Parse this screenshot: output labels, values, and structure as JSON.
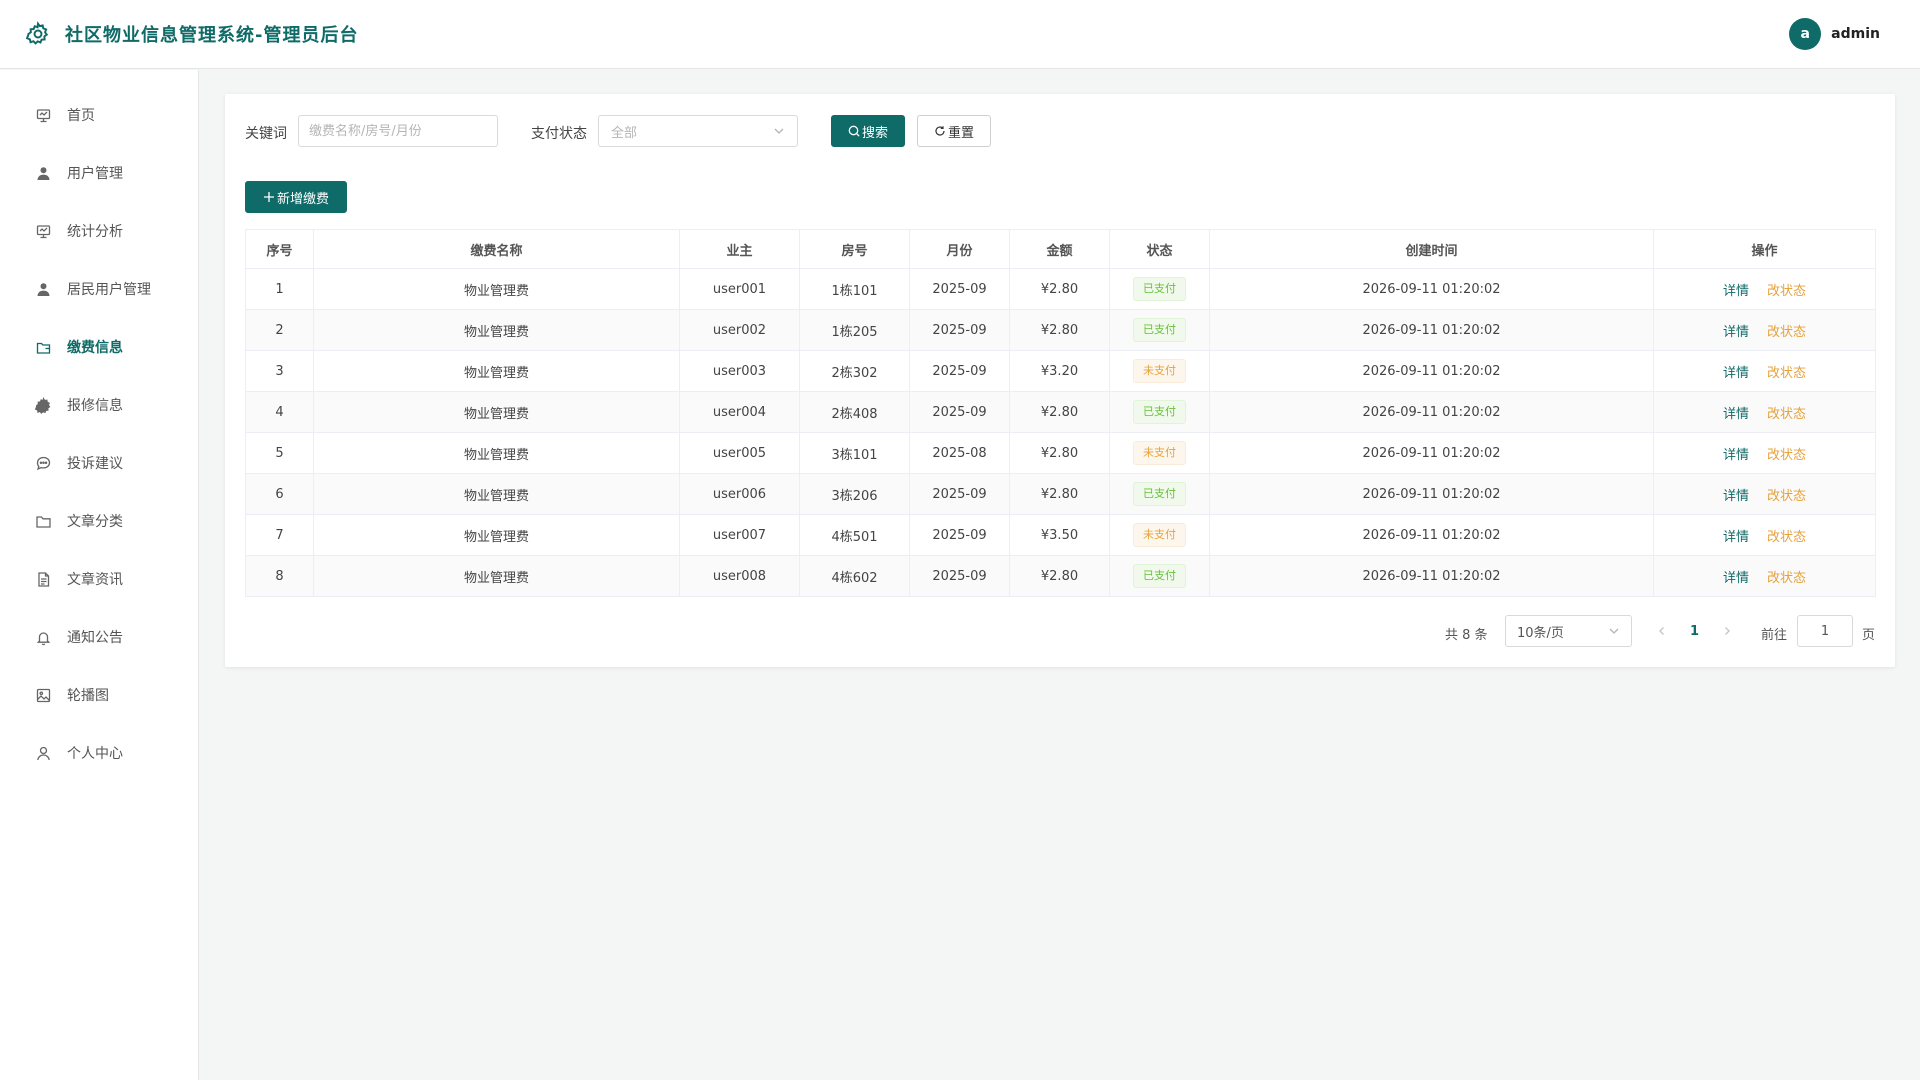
{
  "header": {
    "title": "社区物业信息管理系统-管理员后台",
    "avatar_letter": "a",
    "username": "admin",
    "brand_color": "#0f6b67"
  },
  "sidebar": {
    "items": [
      {
        "label": "首页",
        "icon": "monitor-icon",
        "active": false
      },
      {
        "label": "用户管理",
        "icon": "user-icon",
        "active": false
      },
      {
        "label": "统计分析",
        "icon": "chart-icon",
        "active": false
      },
      {
        "label": "居民用户管理",
        "icon": "user-icon",
        "active": false
      },
      {
        "label": "缴费信息",
        "icon": "wallet-icon",
        "active": true
      },
      {
        "label": "报修信息",
        "icon": "gear-icon",
        "active": false
      },
      {
        "label": "投诉建议",
        "icon": "chat-icon",
        "active": false
      },
      {
        "label": "文章分类",
        "icon": "folder-icon",
        "active": false
      },
      {
        "label": "文章资讯",
        "icon": "document-icon",
        "active": false
      },
      {
        "label": "通知公告",
        "icon": "bell-icon",
        "active": false
      },
      {
        "label": "轮播图",
        "icon": "picture-icon",
        "active": false
      },
      {
        "label": "个人中心",
        "icon": "person-icon",
        "active": false
      }
    ]
  },
  "filters": {
    "keyword_label": "关键词",
    "keyword_placeholder": "缴费名称/房号/月份",
    "keyword_value": "",
    "status_label": "支付状态",
    "status_value": "全部",
    "search_button": "搜索",
    "reset_button": "重置"
  },
  "toolbar": {
    "add_button": "新增缴费"
  },
  "table": {
    "columns": [
      "序号",
      "缴费名称",
      "业主",
      "房号",
      "月份",
      "金额",
      "状态",
      "创建时间",
      "操作"
    ],
    "detail_label": "详情",
    "change_status_label": "改状态",
    "rows": [
      {
        "index": "1",
        "name": "物业管理费",
        "owner": "user001",
        "room": "1栋101",
        "month": "2025-09",
        "amount": "¥2.80",
        "status": "已支付",
        "status_type": "paid",
        "created": "2026-09-11 01:20:02"
      },
      {
        "index": "2",
        "name": "物业管理费",
        "owner": "user002",
        "room": "1栋205",
        "month": "2025-09",
        "amount": "¥2.80",
        "status": "已支付",
        "status_type": "paid",
        "created": "2026-09-11 01:20:02"
      },
      {
        "index": "3",
        "name": "物业管理费",
        "owner": "user003",
        "room": "2栋302",
        "month": "2025-09",
        "amount": "¥3.20",
        "status": "未支付",
        "status_type": "unpaid",
        "created": "2026-09-11 01:20:02"
      },
      {
        "index": "4",
        "name": "物业管理费",
        "owner": "user004",
        "room": "2栋408",
        "month": "2025-09",
        "amount": "¥2.80",
        "status": "已支付",
        "status_type": "paid",
        "created": "2026-09-11 01:20:02"
      },
      {
        "index": "5",
        "name": "物业管理费",
        "owner": "user005",
        "room": "3栋101",
        "month": "2025-08",
        "amount": "¥2.80",
        "status": "未支付",
        "status_type": "unpaid",
        "created": "2026-09-11 01:20:02"
      },
      {
        "index": "6",
        "name": "物业管理费",
        "owner": "user006",
        "room": "3栋206",
        "month": "2025-09",
        "amount": "¥2.80",
        "status": "已支付",
        "status_type": "paid",
        "created": "2026-09-11 01:20:02"
      },
      {
        "index": "7",
        "name": "物业管理费",
        "owner": "user007",
        "room": "4栋501",
        "month": "2025-09",
        "amount": "¥3.50",
        "status": "未支付",
        "status_type": "unpaid",
        "created": "2026-09-11 01:20:02"
      },
      {
        "index": "8",
        "name": "物业管理费",
        "owner": "user008",
        "room": "4栋602",
        "month": "2025-09",
        "amount": "¥2.80",
        "status": "已支付",
        "status_type": "paid",
        "created": "2026-09-11 01:20:02"
      }
    ]
  },
  "pagination": {
    "total_text": "共 8 条",
    "page_size": "10条/页",
    "current_page": "1",
    "goto_label": "前往",
    "goto_value": "1",
    "page_suffix": "页"
  },
  "colors": {
    "paid_text": "#67c23a",
    "unpaid_text": "#e6a23c",
    "change_status_link": "#e6a23c"
  }
}
